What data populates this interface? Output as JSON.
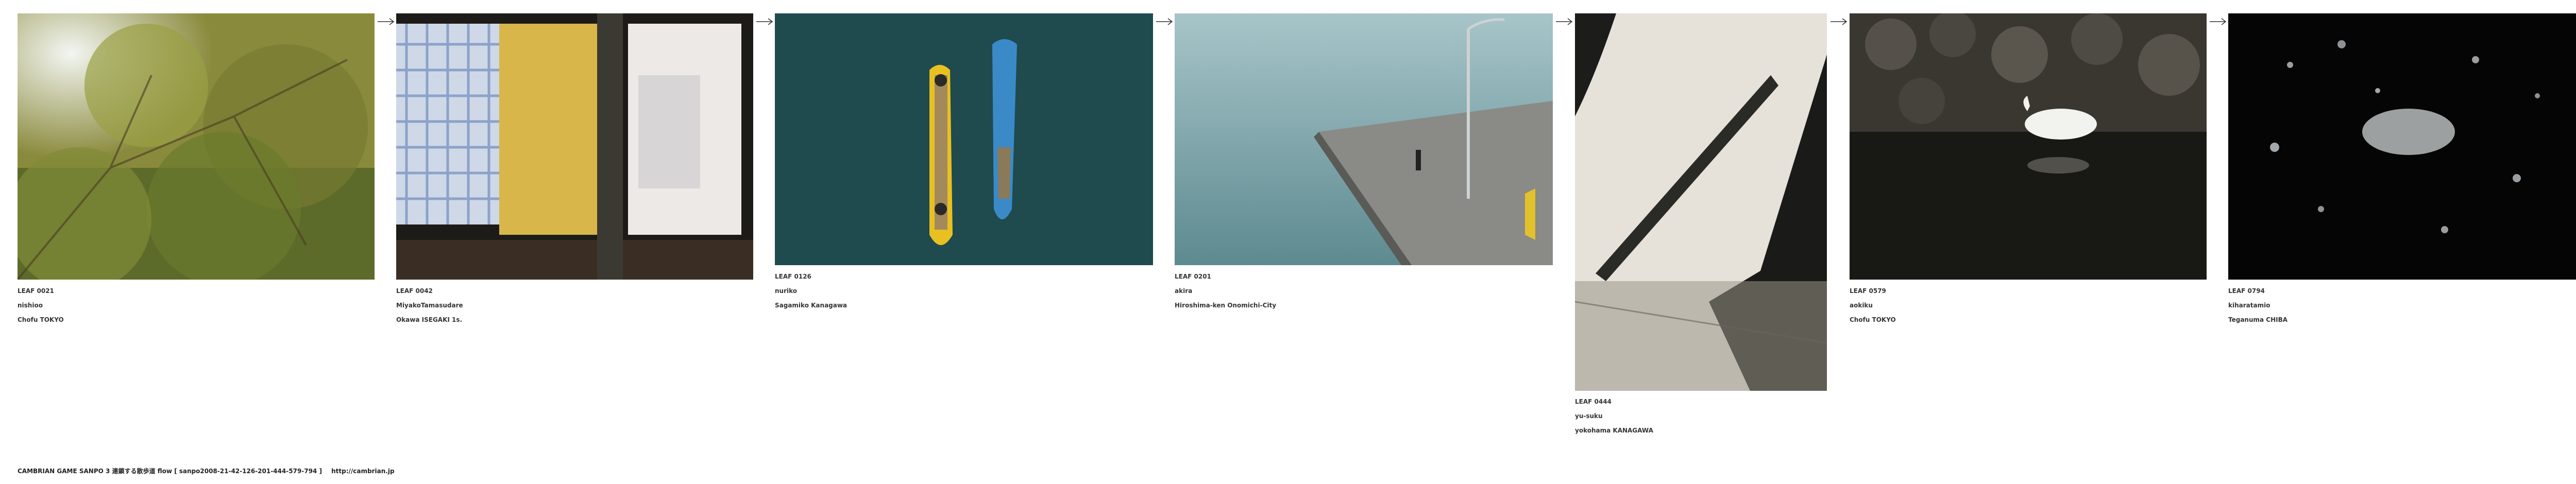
{
  "leaves": [
    {
      "id": "LEAF 0021",
      "author": "nishioo",
      "place": "Chofu TOKYO"
    },
    {
      "id": "LEAF 0042",
      "author": "MiyakoTamasudare",
      "place": "Okawa ISEGAKI 1s."
    },
    {
      "id": "LEAF 0126",
      "author": "nuriko",
      "place": "Sagamiko Kanagawa"
    },
    {
      "id": "LEAF 0201",
      "author": "akira",
      "place": "Hiroshima-ken Onomichi-City"
    },
    {
      "id": "LEAF 0444",
      "author": "yu-suku",
      "place": "yokohama KANAGAWA"
    },
    {
      "id": "LEAF 0579",
      "author": "aokiku",
      "place": "Chofu TOKYO"
    },
    {
      "id": "LEAF 0794",
      "author": "kiharatamio",
      "place": "Teganuma CHIBA"
    }
  ],
  "footer": {
    "text": "CAMBRIAN GAME SANPO 3 連鎖する散歩道 flow [ sanpo2008-21-42-126-201-444-579-794 ]",
    "link": "http://cambrian.jp"
  },
  "icons": {
    "arrow": "right-arrow-icon"
  }
}
